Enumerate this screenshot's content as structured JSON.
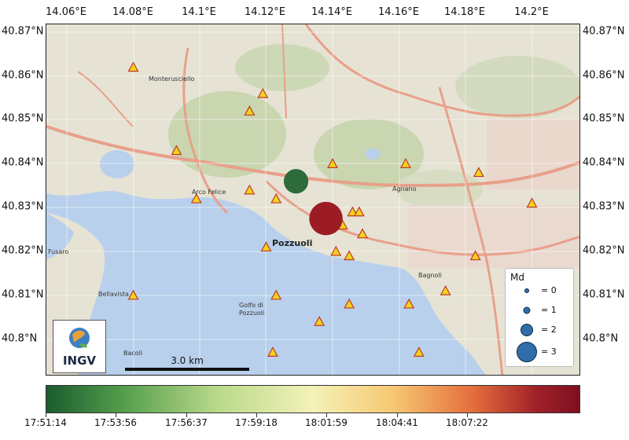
{
  "map": {
    "x_ticks": [
      "14.06°E",
      "14.08°E",
      "14.1°E",
      "14.12°E",
      "14.14°E",
      "14.16°E",
      "14.18°E",
      "14.2°E"
    ],
    "y_ticks": [
      "40.87°N",
      "40.86°N",
      "40.85°N",
      "40.84°N",
      "40.83°N",
      "40.82°N",
      "40.81°N",
      "40.8°N"
    ],
    "places": {
      "monterusciello": "Monterusciello",
      "arco_felice": "Arco Felice",
      "pozzuoli": "Pozzuoli",
      "agnano": "Agnano",
      "bagnoli": "Bagnoli",
      "bellavista": "Bellavista",
      "bacoli": "Bacoli",
      "fusaro": "Fusaro",
      "golfo": "Golfo di",
      "golfo2": "Pozzuoli"
    },
    "scale_bar": "3.0 km",
    "logo_text": "INGV",
    "colors": {
      "sea": "#b8d0ec",
      "land": "#e6e3d4",
      "station": "#f2d31b",
      "station_edge": "#c0392b",
      "event_early": "#2e6b3a",
      "event_late": "#9b1c24"
    }
  },
  "events": [
    {
      "lon": 14.129,
      "lat": 40.836,
      "md": 2.0,
      "time": "17:51:14"
    },
    {
      "lon": 14.138,
      "lat": 40.8275,
      "md": 2.9,
      "time": "18:08:30"
    }
  ],
  "stations": [
    {
      "lon": 14.08,
      "lat": 40.862
    },
    {
      "lon": 14.099,
      "lat": 40.832
    },
    {
      "lon": 14.093,
      "lat": 40.843
    },
    {
      "lon": 14.115,
      "lat": 40.852
    },
    {
      "lon": 14.119,
      "lat": 40.856
    },
    {
      "lon": 14.115,
      "lat": 40.834
    },
    {
      "lon": 14.123,
      "lat": 40.832
    },
    {
      "lon": 14.14,
      "lat": 40.84
    },
    {
      "lon": 14.162,
      "lat": 40.84
    },
    {
      "lon": 14.146,
      "lat": 40.829
    },
    {
      "lon": 14.148,
      "lat": 40.829
    },
    {
      "lon": 14.143,
      "lat": 40.826
    },
    {
      "lon": 14.149,
      "lat": 40.824
    },
    {
      "lon": 14.12,
      "lat": 40.821
    },
    {
      "lon": 14.141,
      "lat": 40.82
    },
    {
      "lon": 14.145,
      "lat": 40.819
    },
    {
      "lon": 14.184,
      "lat": 40.838
    },
    {
      "lon": 14.2,
      "lat": 40.831
    },
    {
      "lon": 14.183,
      "lat": 40.819
    },
    {
      "lon": 14.174,
      "lat": 40.811
    },
    {
      "lon": 14.08,
      "lat": 40.81
    },
    {
      "lon": 14.123,
      "lat": 40.81
    },
    {
      "lon": 14.145,
      "lat": 40.808
    },
    {
      "lon": 14.163,
      "lat": 40.808
    },
    {
      "lon": 14.136,
      "lat": 40.804
    },
    {
      "lon": 14.122,
      "lat": 40.797
    },
    {
      "lon": 14.166,
      "lat": 40.797
    }
  ],
  "legend": {
    "title": "Md",
    "items": [
      {
        "label": "= 0",
        "md": 0
      },
      {
        "label": "= 1",
        "md": 1
      },
      {
        "label": "= 2",
        "md": 2
      },
      {
        "label": "= 3",
        "md": 3
      }
    ]
  },
  "colorbar": {
    "ticks": [
      "17:51:14",
      "17:53:56",
      "17:56:37",
      "17:59:18",
      "18:01:59",
      "18:04:41",
      "18:07:22"
    ]
  }
}
